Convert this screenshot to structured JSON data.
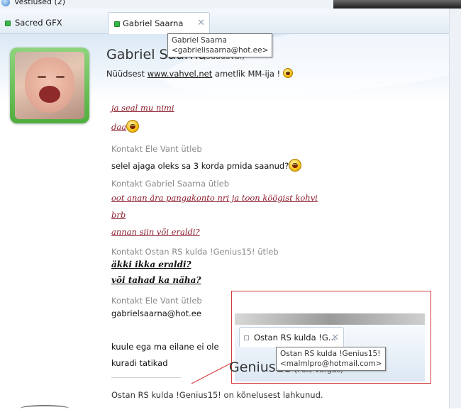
{
  "window": {
    "title": "Vestlused (2)"
  },
  "tabs": [
    {
      "label": "Sacred GFX",
      "active": false
    },
    {
      "label": "Gabriel Saarna",
      "active": true,
      "close": "✕"
    }
  ],
  "tooltip_top": {
    "line1": "Gabriel Saarna",
    "line2": "<gabrielisaarna@hot.ee>"
  },
  "contact": {
    "name": "Gabriel Saarna",
    "status": "(Saadaval)",
    "pm_prefix": "Nüüdsest ",
    "pm_link": "www.vahvel.net",
    "pm_suffix": " ametlik MM-ija ! "
  },
  "messages": {
    "m1": "ja seal mu nimi",
    "m2": "daa",
    "h1": "Kontakt Ele Vant ütleb",
    "m3": "selel ajaga oleks sa 3 korda pmida saanud?",
    "h2": "Kontakt Gabriel Saarna ütleb",
    "m4": "oot anan ära pangakonto nri ja toon köögist kohvi",
    "m5": "brb",
    "m6": "annan  siin või eraldi?",
    "h3": "Kontakt Ostan RS kulda !Genius15! ütleb",
    "m7": "äkki ikka eraldi?",
    "m8": "või tahad ka näha?",
    "h4": "Kontakt Ele Vant ütleb",
    "m9": "gabrielsaarna@hot.ee",
    "m10": "kuule ega ma eilane ei ole",
    "m11": "kuradi tatikad",
    "notice": "Ostan RS kulda !Genius15! on kõnelusest lahkunud."
  },
  "callout": {
    "tab_label": "Ostan RS kulda !G...",
    "tab_close": "✕",
    "tip_line1": "Ostan RS kulda !Genius15!",
    "tip_line2": "<malmlpro@hotmail.com>",
    "name_fragment": "Genius15!",
    "status": "(Pole võrgus)"
  },
  "colors": {
    "accent_red": "#8b1c2c",
    "status_green": "#39b54a",
    "callout_border": "#d03a3a"
  },
  "icons": [
    "app-icon",
    "online-status-icon",
    "close-icon",
    "smiley-icon",
    "avatar"
  ]
}
